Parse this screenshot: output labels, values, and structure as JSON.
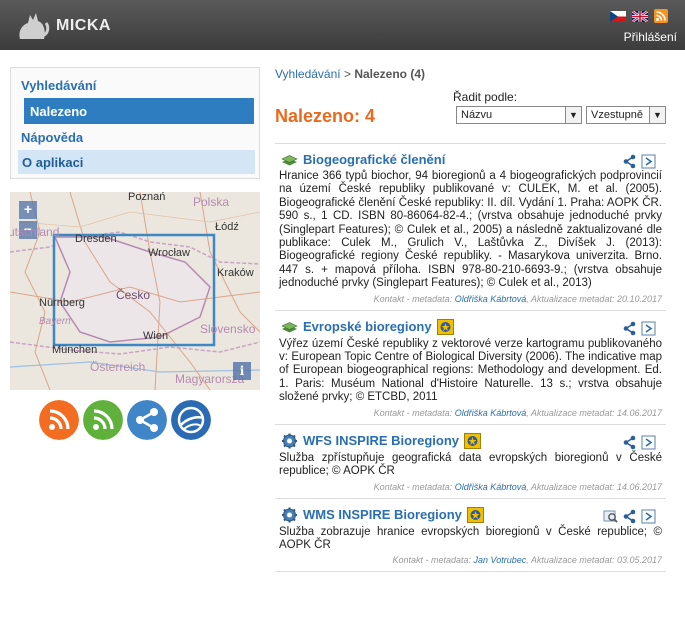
{
  "header": {
    "app_title": "MICKA",
    "login_label": "Přihlášení",
    "flags": [
      "cz-flag-icon",
      "en-flag-icon"
    ],
    "rss_icon": "rss-icon"
  },
  "nav": {
    "items": [
      {
        "label": "Vyhledávání"
      },
      {
        "label": "Nalezeno"
      },
      {
        "label": "Nápověda"
      },
      {
        "label": "O aplikaci"
      }
    ]
  },
  "map": {
    "zoom_in": "+",
    "zoom_out": "−",
    "info": "i",
    "labels": {
      "poznan": "Poznań",
      "polska": "Polska",
      "dresden": "Dresden",
      "wroclaw": "Wrocław",
      "lodz": "Łódź",
      "deutschland": "utschland",
      "krakow": "Kraków",
      "cesko": "Česko",
      "nurnberg": "Nürnberg",
      "bayern": "Bayern",
      "slovensko": "Slovensko",
      "wien": "Wien",
      "munchen": "München",
      "osterreich": "Österreich",
      "magyarorszag": "Magyarorszá"
    }
  },
  "share_buttons": [
    "rss-feed-icon",
    "rss-alt-icon",
    "share-icon",
    "google-earth-icon"
  ],
  "breadcrumb": {
    "search": "Vyhledávání",
    "separator": ">",
    "current": "Nalezeno (4)"
  },
  "results_header": {
    "title": "Nalezeno: 4",
    "sort_label": "Řadit podle:",
    "sort_by": "Názvu",
    "sort_order": "Vzestupně"
  },
  "records": [
    {
      "title": "Biogeografické členění",
      "abstract": "Hranice 366 typů biochor, 94 bioregionů a 4 biogeografických podprovincií na území České republiky publikované v: CULEK, M. et al. (2005). Biogeografické členění České republiky: II. díl. Vydání 1. Praha: AOPK ČR. 590 s., 1 CD. ISBN 80-86064-82-4.; (vrstva obsahuje jednoduché prvky (Singlepart Features); © Culek et al., 2005) a následně zaktualizované dle publikace: Culek M., Grulich V., Laštůvka Z., Divíšek J. (2013): Biogeografické regiony České republiky. - Masarykova univerzita. Brno. 447 s. + mapová příloha. ISBN 978-80-210-6693-9.; (vrstva obsahuje jednoduché prvky (Singlepart Features); © Culek et al., 2013)",
      "meta_prefix": "Kontakt - metadata:",
      "contact": "Oldřiška Kábrtová",
      "meta_suffix": ", Aktualizace metadat: 20.10.2017"
    },
    {
      "title": "Evropské bioregiony",
      "abstract": "Výřez území České republiky z vektorové verze kartogramu publikovaného v: European Topic Centre of Biological Diversity (2006). The indicative map of European biogeographical regions: Methodology and development. Ed. 1. Paris: Muséum National d'Histoire Naturelle. 13 s.; vrstva obsahuje složené prvky; © ETCBD, 2011",
      "meta_prefix": "Kontakt - metadata:",
      "contact": "Oldřiška Kábrtová",
      "meta_suffix": ", Aktualizace metadat: 14.06.2017"
    },
    {
      "title": "WFS INSPIRE Bioregiony",
      "abstract": "Služba zpřístupňuje geografická data evropských bioregionů v České republice; © AOPK ČR",
      "meta_prefix": "Kontakt - metadata:",
      "contact": "Oldřiška Kábrtová",
      "meta_suffix": ", Aktualizace metadat: 14.06.2017"
    },
    {
      "title": "WMS INSPIRE Bioregiony",
      "abstract": "Služba zobrazuje hranice evropských bioregionů v České republice; © AOPK ČR",
      "meta_prefix": "Kontakt - metadata:",
      "contact": "Jan Votrubec",
      "meta_suffix": ", Aktualizace metadat: 03.05.2017"
    }
  ],
  "colors": {
    "accent": "#2e7dc1",
    "found_title": "#e96a1e",
    "link": "#2a6fb0",
    "header_bg": "#4a4a4a"
  }
}
